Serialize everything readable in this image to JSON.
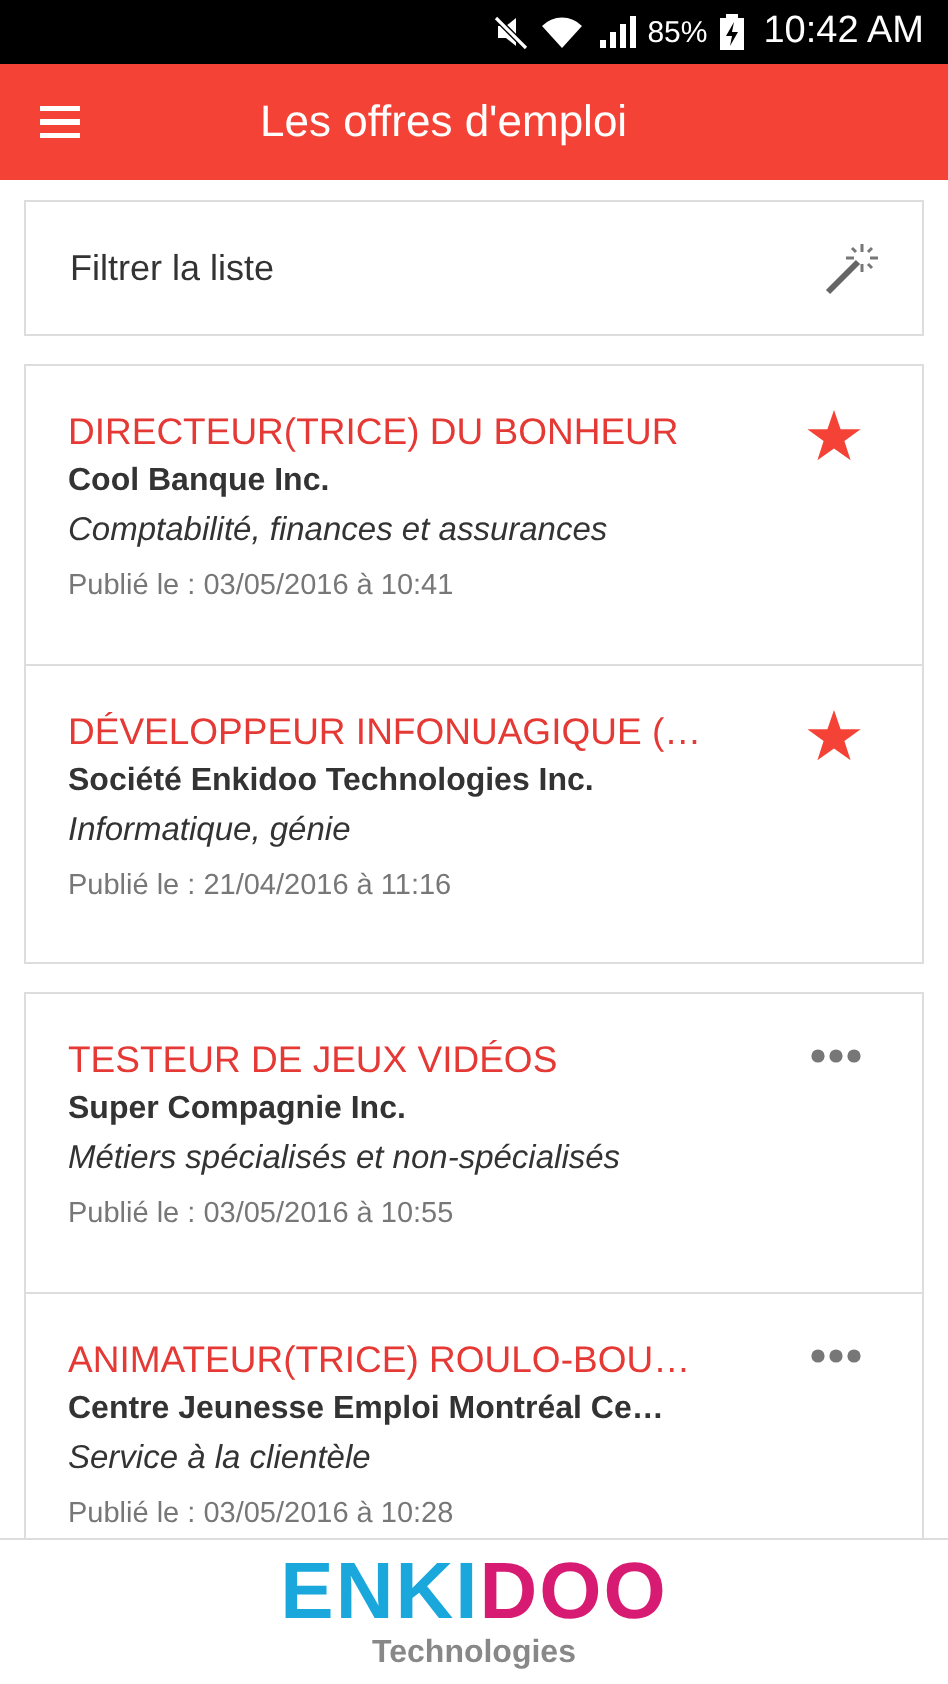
{
  "status_bar": {
    "battery": "85%",
    "time": "10:42 AM"
  },
  "app_bar": {
    "title": "Les offres d'emploi"
  },
  "filter": {
    "label": "Filtrer la liste"
  },
  "groups": [
    {
      "jobs": [
        {
          "title": "DIRECTEUR(TRICE) DU BONHEUR",
          "company": "Cool Banque Inc.",
          "category": "Comptabilité, finances et assurances",
          "date": "Publié le : 03/05/2016 à 10:41",
          "favorite": true
        },
        {
          "title": "DÉVELOPPEUR INFONUAGIQUE (…",
          "company": "Société Enkidoo Technologies Inc.",
          "category": "Informatique, génie",
          "date": "Publié le : 21/04/2016 à 11:16",
          "favorite": true
        }
      ]
    },
    {
      "jobs": [
        {
          "title": "TESTEUR DE JEUX VIDÉOS",
          "company": "Super Compagnie Inc.",
          "category": "Métiers spécialisés et non-spécialisés",
          "date": "Publié le : 03/05/2016 à 10:55",
          "favorite": false
        },
        {
          "title": "ANIMATEUR(TRICE) ROULO-BOU…",
          "company": "Centre Jeunesse Emploi Montréal Ce…",
          "category": "Service à la clientèle",
          "date": "Publié le : 03/05/2016 à 10:28",
          "favorite": false
        }
      ]
    }
  ],
  "footer": {
    "logo_parts": [
      {
        "text": "ENKI",
        "color": "#1aa8dc"
      },
      {
        "text": "DOO",
        "color": "#d81b72"
      }
    ],
    "tagline": "Technologies"
  }
}
